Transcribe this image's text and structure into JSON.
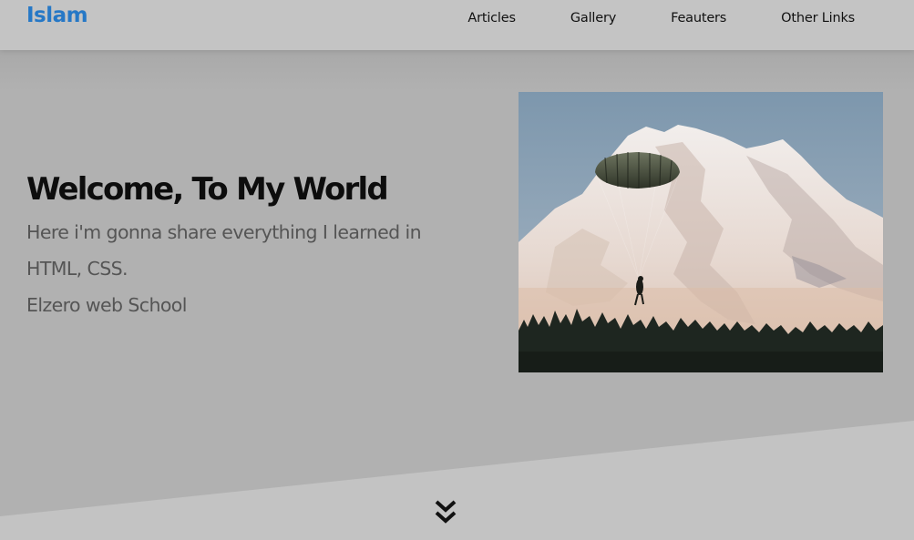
{
  "header": {
    "logo": "Islam",
    "nav": [
      "Articles",
      "Gallery",
      "Feauters",
      "Other Links"
    ]
  },
  "landing": {
    "title": "Welcome, To My World",
    "description_lines": [
      "Here i'm gonna share everything I learned in",
      "HTML, CSS.",
      "Elzero web School"
    ]
  },
  "icons": {
    "go_down": "chevrons-down-icon"
  },
  "colors": {
    "logo": "#2678c6",
    "header_bg": "#c4c4c4",
    "landing_bg": "#b1b1b1",
    "title": "#0d0d0d",
    "description": "#555555"
  }
}
